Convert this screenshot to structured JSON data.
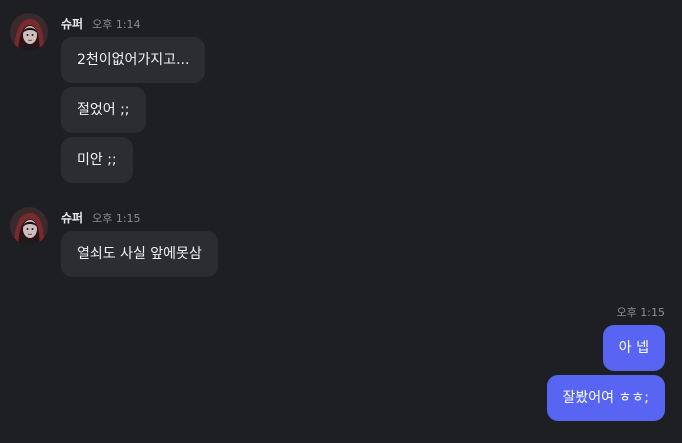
{
  "colors": {
    "background": "#1e1f22",
    "incoming_bubble": "#2b2d31",
    "outgoing_bubble": "#5865f2",
    "timestamp": "#8b8e94"
  },
  "groups": [
    {
      "sender": "슈퍼",
      "time": "오후 1:14",
      "messages": [
        "2천이없어가지고...",
        "절었어 ;;",
        "미안 ;;"
      ]
    },
    {
      "sender": "슈퍼",
      "time": "오후 1:15",
      "messages": [
        "열쇠도 사실 앞에못삼"
      ]
    }
  ],
  "outgoing": {
    "time": "오후 1:15",
    "messages": [
      "아 넵",
      "잘봤어여 ㅎㅎ;"
    ]
  }
}
